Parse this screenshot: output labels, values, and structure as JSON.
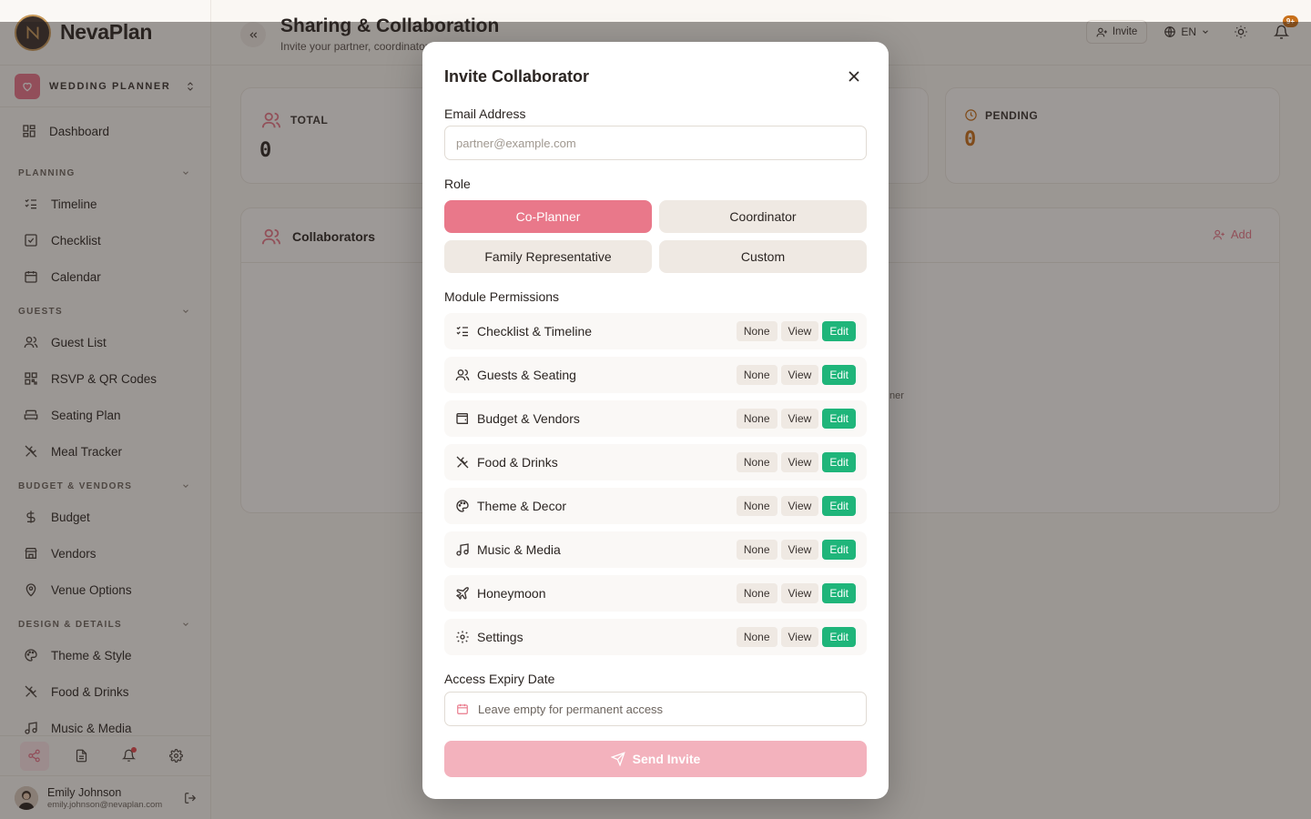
{
  "app": {
    "name": "NevaPlan"
  },
  "planner": {
    "label": "WEDDING PLANNER"
  },
  "nav": {
    "dashboard": "Dashboard",
    "sections": [
      {
        "title": "PLANNING",
        "items": [
          "Timeline",
          "Checklist",
          "Calendar"
        ]
      },
      {
        "title": "GUESTS",
        "items": [
          "Guest List",
          "RSVP & QR Codes",
          "Seating Plan",
          "Meal Tracker"
        ]
      },
      {
        "title": "BUDGET & VENDORS",
        "items": [
          "Budget",
          "Vendors",
          "Venue Options"
        ]
      },
      {
        "title": "DESIGN & DETAILS",
        "items": [
          "Theme & Style",
          "Food & Drinks",
          "Music & Media"
        ]
      }
    ]
  },
  "user": {
    "name": "Emily Johnson",
    "email": "emily.johnson@nevaplan.com"
  },
  "header": {
    "title": "Sharing & Collaboration",
    "subtitle": "Invite your partner, coordinator",
    "invite_label": "Invite",
    "lang": "EN",
    "notif_badge": "9+"
  },
  "stats": {
    "total_label": "TOTAL",
    "total_value": "0",
    "pending_label": "PENDING",
    "pending_value": "0"
  },
  "collaborators": {
    "title": "Collaborators",
    "add_label": "Add",
    "empty_fragment": "ner"
  },
  "modal": {
    "title": "Invite Collaborator",
    "email_label": "Email Address",
    "email_placeholder": "partner@example.com",
    "role_label": "Role",
    "roles": [
      "Co-Planner",
      "Coordinator",
      "Family Representative",
      "Custom"
    ],
    "selected_role": "Co-Planner",
    "permissions_label": "Module Permissions",
    "permission_options": [
      "None",
      "View",
      "Edit"
    ],
    "modules": [
      {
        "name": "Checklist & Timeline",
        "icon": "list-checks-icon",
        "level": "Edit"
      },
      {
        "name": "Guests & Seating",
        "icon": "users-icon",
        "level": "Edit"
      },
      {
        "name": "Budget & Vendors",
        "icon": "wallet-icon",
        "level": "Edit"
      },
      {
        "name": "Food & Drinks",
        "icon": "utensils-icon",
        "level": "Edit"
      },
      {
        "name": "Theme & Decor",
        "icon": "palette-icon",
        "level": "Edit"
      },
      {
        "name": "Music & Media",
        "icon": "music-icon",
        "level": "Edit"
      },
      {
        "name": "Honeymoon",
        "icon": "plane-icon",
        "level": "Edit"
      },
      {
        "name": "Settings",
        "icon": "gear-icon",
        "level": "Edit"
      }
    ],
    "expiry_label": "Access Expiry Date",
    "expiry_placeholder": "Leave empty for permanent access",
    "send_label": "Send Invite"
  },
  "colors": {
    "accent": "#e9788a",
    "edit_active": "#1fb57a",
    "pending": "#c8701a"
  }
}
